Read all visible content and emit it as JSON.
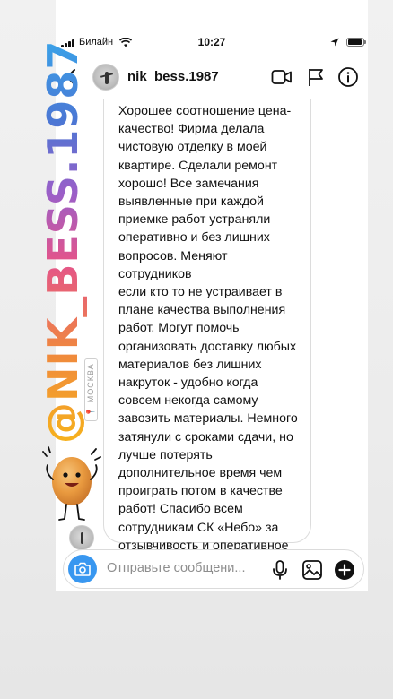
{
  "status_bar": {
    "carrier": "Билайн",
    "time": "10:27"
  },
  "header": {
    "username": "nik_bess.1987",
    "icons": [
      "back-arrow-icon",
      "video-call-icon",
      "flag-icon",
      "info-icon"
    ]
  },
  "message": {
    "text": "Хорошее соотношение цена-\nкачество! Фирма делала\nчистовую отделку в моей\nквартире. Сделали ремонт\nхорошо! Все замечания\nвыявленные при каждой\nприемке работ устраняли\nоперативно и без лишних\nвопросов. Меняют сотрудников\nесли кто то не устраивает в\nплане качества выполнения\nработ. Могут помочь\nорганизовать доставку любых\nматериалов без лишних\nнакруток - удобно когда\nсовсем некогда самому\nзавозить материалы. Немного\nзатянули с сроками сдачи, но\nлучше потерять\nдополнительное время чем\nпроиграть потом в качестве\nработ! Спасибо всем\nсотрудникам СК «Небо» за\nотзывчивость и оперативное\nрешение вопросов."
  },
  "sticker": {
    "handle": "@NIK_BESS.1987",
    "location": "МОСКВА",
    "colors": [
      "#f6b21b",
      "#f08a3c",
      "#e4548a",
      "#9b5fc8",
      "#4b77d4",
      "#3aa2e8"
    ]
  },
  "composer": {
    "placeholder": "Отправьте сообщени...",
    "value": "",
    "icons": [
      "camera-icon",
      "microphone-icon",
      "gallery-icon",
      "plus-icon"
    ],
    "accent": "#3897f0"
  }
}
